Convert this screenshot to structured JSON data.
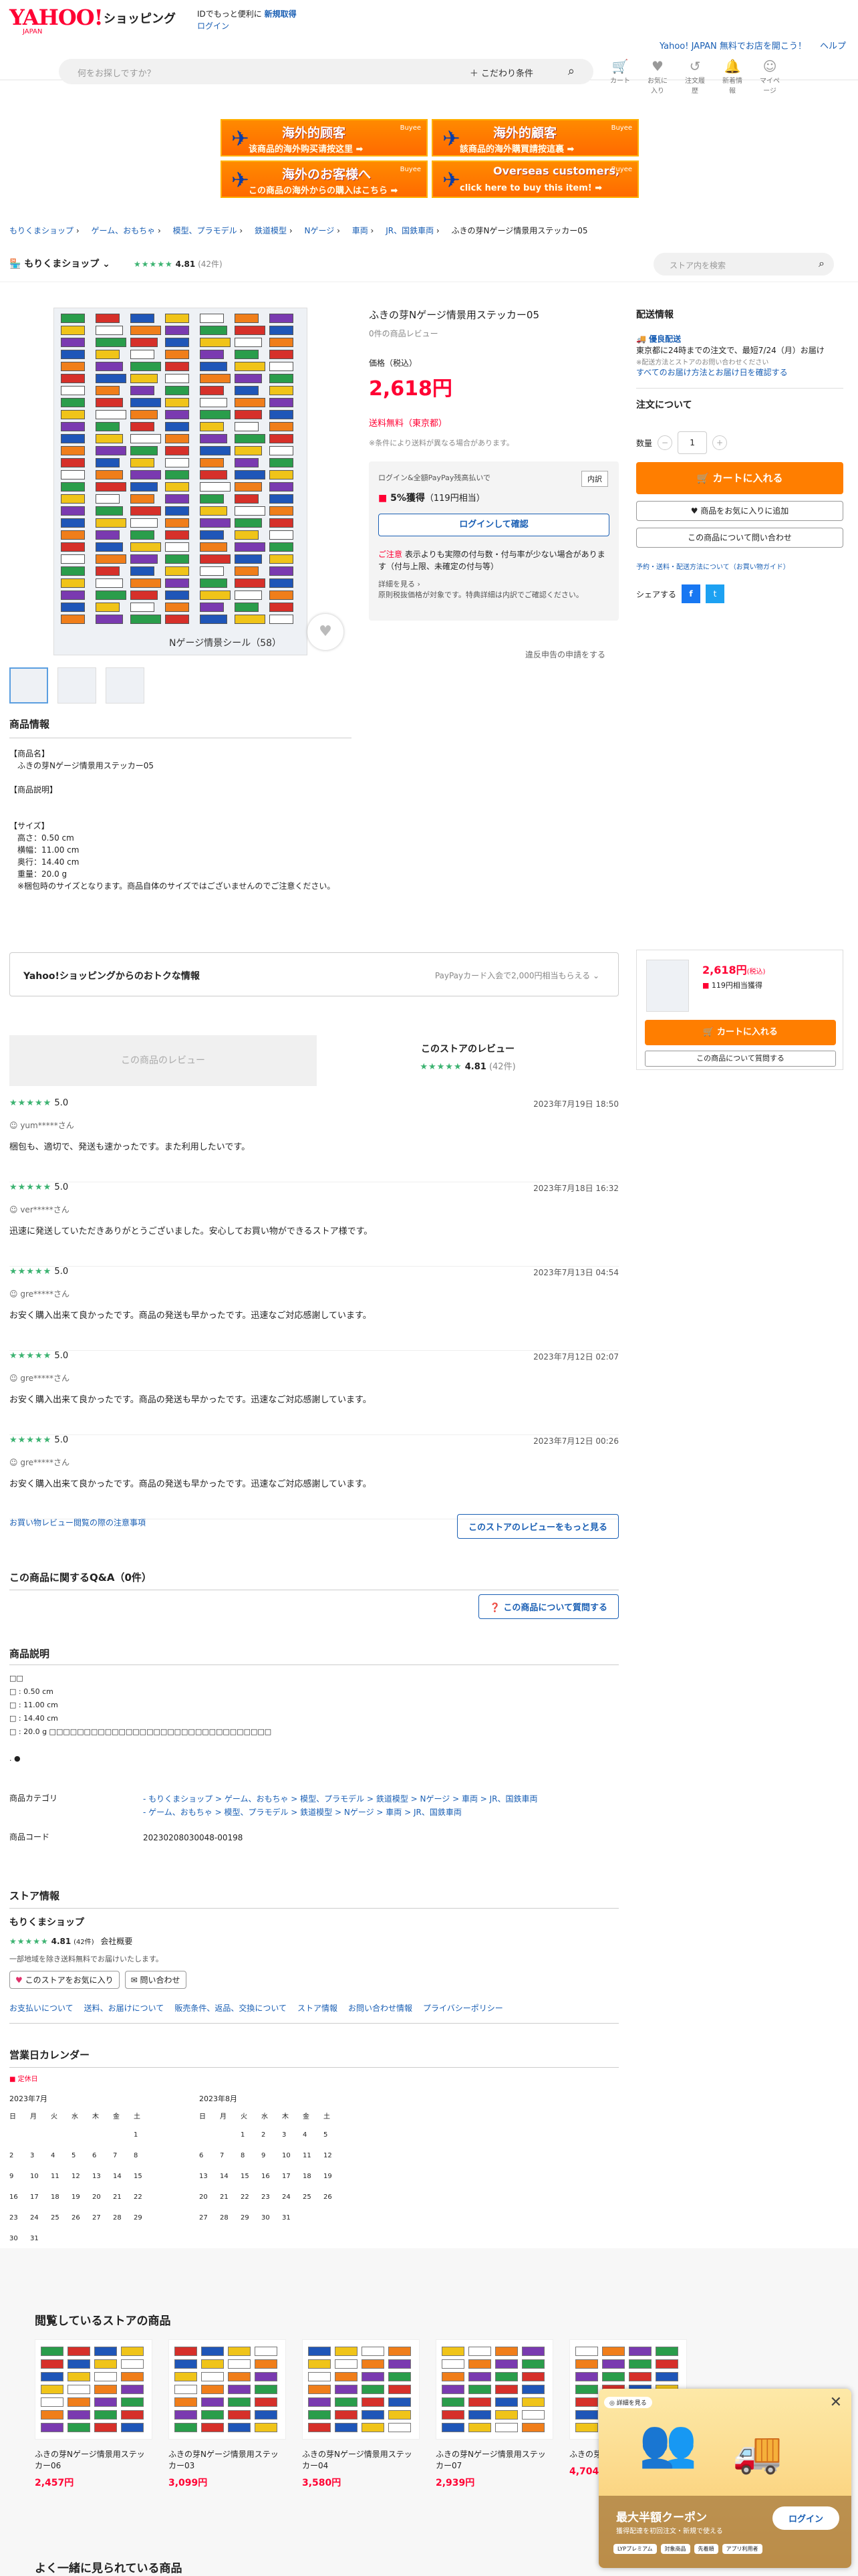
{
  "header": {
    "logo": "YAHOO!",
    "logo_sub": "JAPAN",
    "shopping": "ショッピング",
    "register_line": "IDでもっと便利に",
    "register_link": "新規取得",
    "login": "ログイン",
    "link_open_store": "Yahoo! JAPAN  無料でお店を開こう！",
    "link_help": "ヘルプ",
    "search_placeholder": "何をお探しですか？",
    "search_filter": "＋ こだわり条件",
    "icons": [
      {
        "icon": "cart-icon",
        "label": "カート"
      },
      {
        "icon": "heart-icon",
        "label": "お気に入り"
      },
      {
        "icon": "history-icon",
        "label": "注文履歴"
      },
      {
        "icon": "bell-icon",
        "label": "新着情報"
      },
      {
        "icon": "user-icon",
        "label": "マイページ"
      }
    ]
  },
  "banners": [
    {
      "t1": "海外的顾客",
      "t2": "该商品的海外购买请按这里 ➡"
    },
    {
      "t1": "海外的顧客",
      "t2": "該商品的海外購買請按這裏 ➡"
    },
    {
      "t1": "海外のお客様へ",
      "t2": "この商品の海外からの購入はこちら ➡"
    },
    {
      "t1": "Overseas customers,",
      "t2": "click here to buy this item! ➡"
    }
  ],
  "buyee_label": "Buyee",
  "breadcrumb": [
    "もりくまショップ",
    "ゲーム、おもちゃ",
    "模型、プラモデル",
    "鉄道模型",
    "Nゲージ",
    "車両",
    "JR、国鉄車両",
    "ふきの芽Nゲージ情景用ステッカー05"
  ],
  "store": {
    "name": "もりくまショップ",
    "rating": "4.81",
    "count": "(42件)",
    "search_placeholder": "ストア内を検索"
  },
  "product": {
    "name": "ふきの芽Nゲージ情景用ステッカー05",
    "review_count": "0件の商品レビュー",
    "price_label": "価格（税込）",
    "price": "2,618円",
    "shipping": "送料無料（東京都）",
    "shipping_note": "※条件により送料が異なる場合があります。",
    "point_note": "ログイン&全額PayPay残高払いで",
    "point_badge": "内訳",
    "point_pct": "5%獲得",
    "point_amt": "（119円相当）",
    "login_btn": "ログインして確認",
    "caution_head": "ご注意",
    "caution": "表示よりも実際の付与数・付与率が少ない場合があります（付与上限、未確定の付与等）",
    "detail_link": "詳細を見る",
    "detail_note": "原則税抜価格が対象です。特典詳細は内訳でご確認ください。",
    "image_caption": "Nゲージ情景シール（58）",
    "report": "違反申告の申請をする"
  },
  "delivery": {
    "title": "配送情報",
    "speed": "優良配送",
    "line1": "東京都に24時までの注文で、最短7/24（月）お届け",
    "line2": "※配送方法とストアのお問い合わせください",
    "line3": "すべてのお届け方法とお届け日を確認する"
  },
  "order": {
    "title": "注文について",
    "qty_label": "数量",
    "qty": "1",
    "cart": "カートに入れる",
    "fav": "商品をお気に入りに追加",
    "ask": "この商品について問い合わせ",
    "links": "予約・送料・配送方法について（お買い物ガイド）",
    "share": "シェアする"
  },
  "info": {
    "title": "商品情報",
    "lines": [
      "【商品名】",
      "　ふきの芽Nゲージ情景用ステッカー05",
      "",
      "【商品説明】",
      "",
      "",
      "【サイズ】",
      "　高さ：0.50 cm",
      "　横幅：11.00 cm",
      "　奥行：14.40 cm",
      "　重量：20.0 g",
      "　※梱包時のサイズとなります。商品自体のサイズではございませんのでご注意ください。"
    ]
  },
  "deals": {
    "title": "Yahoo!ショッピングからのおトクな情報",
    "right": "PayPayカード入会で2,000円相当もらえる ⌄"
  },
  "sticky": {
    "price": "2,618円",
    "tax": "(税込)",
    "point": "119円相当獲得",
    "cart": "カートに入れる",
    "ask": "この商品について質問する"
  },
  "reviews": {
    "tab_product": "この商品のレビュー",
    "tab_store": "このストアのレビュー",
    "store_rating": "4.81",
    "store_count": "(42件)",
    "items": [
      {
        "score": "5.0",
        "date": "2023年7月19日 18:50",
        "user": "yum*****さん",
        "text": "梱包も、適切で、発送も速かったです。また利用したいです。"
      },
      {
        "score": "5.0",
        "date": "2023年7月18日 16:32",
        "user": "ver*****さん",
        "text": "迅速に発送していただきありがとうございました。安心してお買い物ができるストア様です。"
      },
      {
        "score": "5.0",
        "date": "2023年7月13日 04:54",
        "user": "gre*****さん",
        "text": "お安く購入出来て良かったです。商品の発送も早かったです。迅速なご対応感謝しています。"
      },
      {
        "score": "5.0",
        "date": "2023年7月12日 02:07",
        "user": "gre*****さん",
        "text": "お安く購入出来て良かったです。商品の発送も早かったです。迅速なご対応感謝しています。"
      },
      {
        "score": "5.0",
        "date": "2023年7月12日 00:26",
        "user": "gre*****さん",
        "text": "お安く購入出来て良かったです。商品の発送も早かったです。迅速なご対応感謝しています。"
      }
    ],
    "caution_link": "お買い物レビュー閲覧の際の注意事項",
    "more": "このストアのレビューをもっと見る"
  },
  "qa": {
    "title": "この商品に関するQ&A（0件）",
    "ask": "この商品について質問する"
  },
  "desc": {
    "title": "商品説明",
    "lines": [
      "□□",
      "□ : 0.50 cm",
      "□ : 11.00 cm",
      "□ : 14.40 cm",
      "□ : 20.0 g □□□□□□□□□□□□□□□□□□□□□□□□□□□□□□□□",
      "",
      ". ●"
    ]
  },
  "meta": {
    "cat_label": "商品カテゴリ",
    "cat1": "- もりくまショップ > ゲーム、おもちゃ > 模型、プラモデル > 鉄道模型 > Nゲージ > 車両 > JR、国鉄車両",
    "cat2": "- ゲーム、おもちゃ > 模型、プラモデル > 鉄道模型 > Nゲージ > 車両 > JR、国鉄車両",
    "code_label": "商品コード",
    "code": "20230208030048-00198"
  },
  "storeinfo": {
    "title": "ストア情報",
    "name": "もりくまショップ",
    "rating": "4.81",
    "count": "(42件)",
    "summary": "会社概要",
    "notice": "一部地域を除き送料無料でお届けいたします。",
    "fav": "このストアをお気に入り",
    "contact": "問い合わせ",
    "links": [
      "お支払いについて",
      "送料、お届けについて",
      "販売条件、返品、交換について",
      "ストア情報",
      "お問い合わせ情報",
      "プライバシーポリシー"
    ]
  },
  "calendar": {
    "title": "営業日カレンダー",
    "legend": "■ 定休日",
    "weekdays": [
      "日",
      "月",
      "火",
      "水",
      "木",
      "金",
      "土"
    ],
    "months": [
      {
        "name": "2023年7月",
        "lead": 6,
        "days": 31
      },
      {
        "name": "2023年8月",
        "lead": 2,
        "days": 31
      }
    ]
  },
  "recent": {
    "title": "閲覧しているストアの商品",
    "items": [
      {
        "name": "ふきの芽Nゲージ情景用ステッカー06",
        "price": "2,457円"
      },
      {
        "name": "ふきの芽Nゲージ情景用ステッカー03",
        "price": "3,099円"
      },
      {
        "name": "ふきの芽Nゲージ情景用ステッカー04",
        "price": "3,580円"
      },
      {
        "name": "ふきの芽Nゲージ情景用ステッカー07",
        "price": "2,939円"
      },
      {
        "name": "ふきの芽",
        "price": "4,704円"
      }
    ]
  },
  "also_title": "よく一緒に見られている商品",
  "coupon": {
    "tag": "◎ 詳細を見る",
    "title": "最大半額クーポン",
    "sub": "獲得配達を初回注文・新規で使える",
    "login": "ログイン",
    "tags": [
      "LYPプレミアム",
      "対象商品",
      "先着順",
      "アプリ利用者"
    ]
  }
}
